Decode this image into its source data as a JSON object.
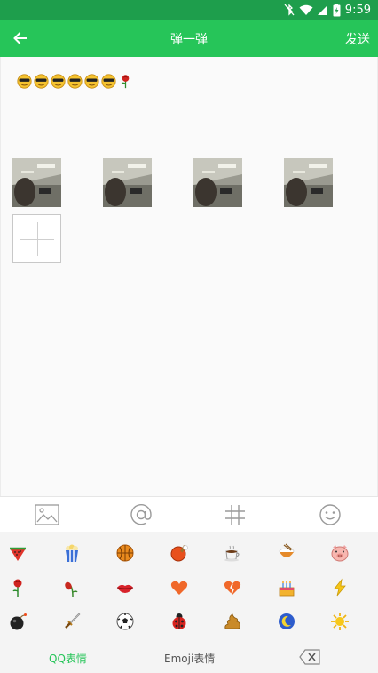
{
  "status_bar": {
    "time": "9:59"
  },
  "app_bar": {
    "title": "弹一弹",
    "send_label": "发送"
  },
  "post": {
    "emoji": [
      "cool-face",
      "cool-face",
      "cool-face",
      "cool-face",
      "cool-face",
      "cool-face",
      "rose"
    ]
  },
  "photos": {
    "count": 4
  },
  "toolbar": {
    "items": [
      "image-icon",
      "at-icon",
      "hashtag-icon",
      "smiley-icon"
    ]
  },
  "emoji_panel": {
    "rows": [
      [
        "watermelon",
        "popcorn",
        "basketball",
        "ping-pong",
        "coffee",
        "rice-bowl",
        "pig-face"
      ],
      [
        "rose",
        "wilted-flower",
        "lips",
        "heart",
        "broken-heart",
        "cake",
        "lightning"
      ],
      [
        "bomb",
        "dagger",
        "soccer-ball",
        "ladybug",
        "poop",
        "moon",
        "sun"
      ]
    ]
  },
  "panel_tabs": {
    "qq": "QQ表情",
    "emoji": "Emoji表情"
  },
  "colors": {
    "status_bar": "#1e9e4c",
    "app_bar": "#26c559",
    "accent": "#26c559"
  }
}
